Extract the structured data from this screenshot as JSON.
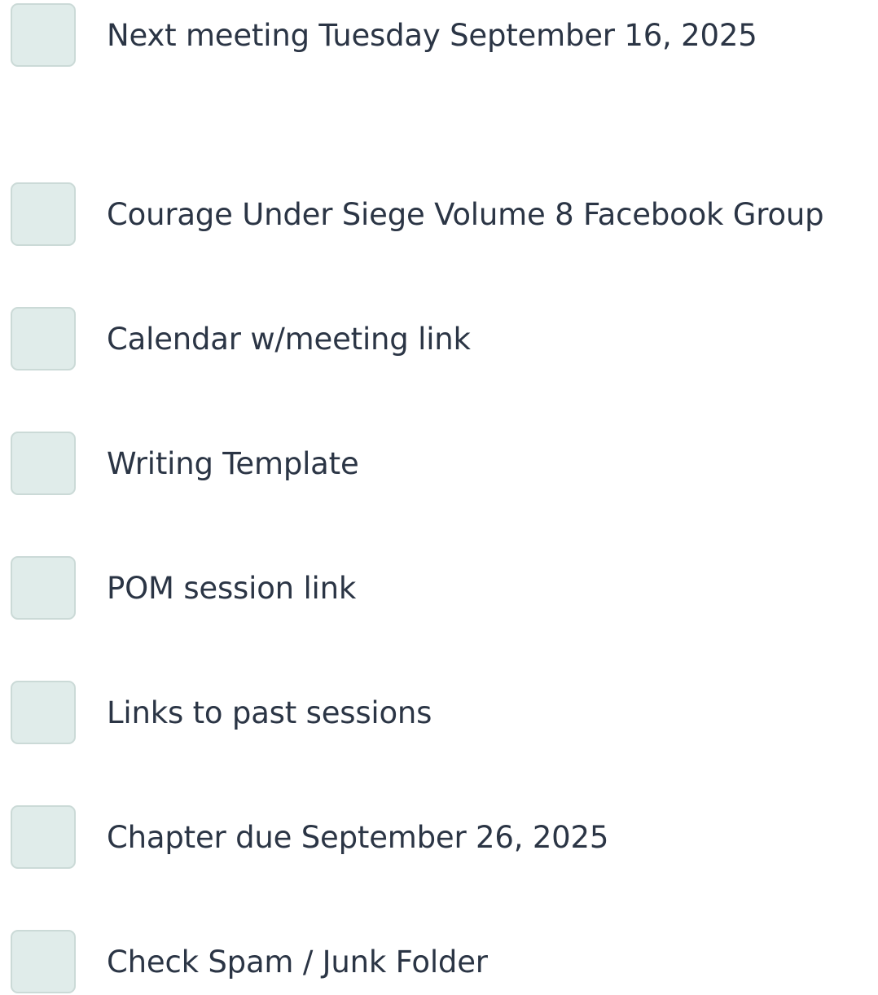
{
  "checklist": {
    "items": [
      {
        "label": "Next meeting Tuesday September 16, 2025",
        "checked": false
      },
      {
        "label": "Courage Under Siege Volume 8 Facebook Group",
        "checked": false
      },
      {
        "label": "Calendar w/meeting link",
        "checked": false
      },
      {
        "label": "Writing Template",
        "checked": false
      },
      {
        "label": "POM session link",
        "checked": false
      },
      {
        "label": "Links to past sessions",
        "checked": false
      },
      {
        "label": "Chapter due September 26, 2025",
        "checked": false
      },
      {
        "label": "Check Spam / Junk Folder",
        "checked": false
      }
    ]
  },
  "colors": {
    "checkbox_fill": "#e0ecea",
    "checkbox_border": "#cbdad7",
    "text": "#2b3545",
    "background": "#ffffff"
  }
}
